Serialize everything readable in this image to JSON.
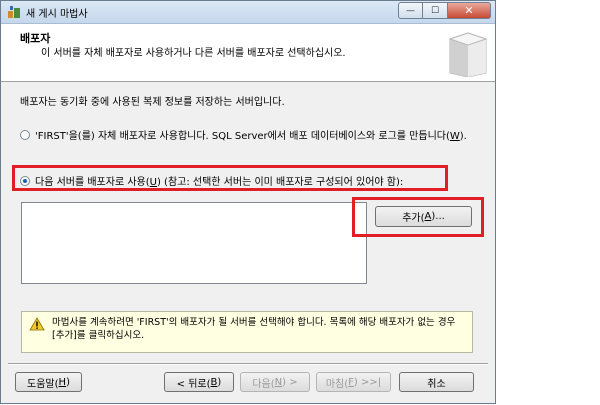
{
  "window": {
    "title": "새 게시 마법사",
    "controls": {
      "minimize": "—",
      "maximize": "☐",
      "close": "✕"
    }
  },
  "header": {
    "title": "배포자",
    "subtitle": "이 서버를 자체 배포자로 사용하거나 다른 서버를 배포자로 선택하십시오."
  },
  "content": {
    "description": "배포자는 동기화 중에 사용된 복제 정보를 저장하는 서버입니다.",
    "option_self": {
      "text_before": "'FIRST'을(를) 자체 배포자로 사용합니다. SQL Server에서 배포 데이터베이스와 로그를 만듭니다(",
      "hotkey": "W",
      "text_after": ").",
      "selected": false
    },
    "option_other": {
      "text_before": "다음 서버를 배포자로 사용(",
      "hotkey": "U",
      "text_after": ") (참고: 선택한 서버는 이미 배포자로 구성되어 있어야 함):",
      "selected": true
    },
    "add_button": {
      "text_before": "추가(",
      "hotkey": "A",
      "text_after": ")..."
    },
    "warning": "마법사를 계속하려면 'FIRST'의 배포자가 될 서버를 선택해야 합니다. 목록에 해당 배포자가 없는 경우 [추가]를 클릭하십시오."
  },
  "footer": {
    "help": {
      "text_before": "도움말(",
      "hotkey": "H",
      "text_after": ")"
    },
    "back": {
      "text_before": "< 뒤로(",
      "hotkey": "B",
      "text_after": ")"
    },
    "next": {
      "text_before": "다음(",
      "hotkey": "N",
      "text_after": ") >"
    },
    "finish": {
      "text_before": "마침(",
      "hotkey": "F",
      "text_after": ") >>|"
    },
    "cancel": "취소"
  },
  "colors": {
    "highlight_box": "#e01e26",
    "warning_bg": "#ffffe1",
    "window_bg": "#f0f0f0"
  },
  "icons": {
    "app": "wizard-icon",
    "header_art": "server-box-icon",
    "warning": "warning-icon"
  }
}
